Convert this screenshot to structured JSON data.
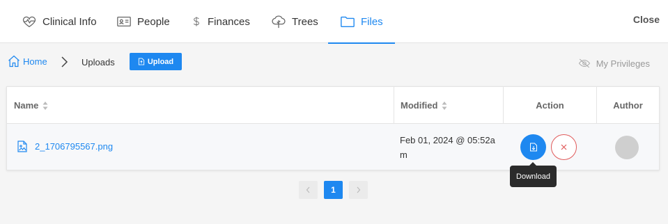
{
  "tabs": [
    {
      "label": "Clinical Info",
      "icon": "heart-pulse-icon",
      "active": false
    },
    {
      "label": "People",
      "icon": "id-card-icon",
      "active": false
    },
    {
      "label": "Finances",
      "icon": "dollar-icon",
      "active": false
    },
    {
      "label": "Trees",
      "icon": "tree-icon",
      "active": false
    },
    {
      "label": "Files",
      "icon": "folder-icon",
      "active": true
    }
  ],
  "close_label": "Close",
  "breadcrumb": {
    "home": "Home",
    "current": "Uploads"
  },
  "upload_label": "Upload",
  "privileges_label": "My Privileges",
  "table": {
    "headers": {
      "name": "Name",
      "modified": "Modified",
      "action": "Action",
      "author": "Author"
    },
    "rows": [
      {
        "name": "2_1706795567.png",
        "modified_line1": "Feb 01, 2024 @ 05:52a",
        "modified_line2": "m"
      }
    ]
  },
  "tooltip": "Download",
  "pagination": {
    "current": "1"
  },
  "colors": {
    "accent": "#1e88f0",
    "danger": "#e05a5a",
    "tooltip_bg": "#2b2b2b"
  }
}
